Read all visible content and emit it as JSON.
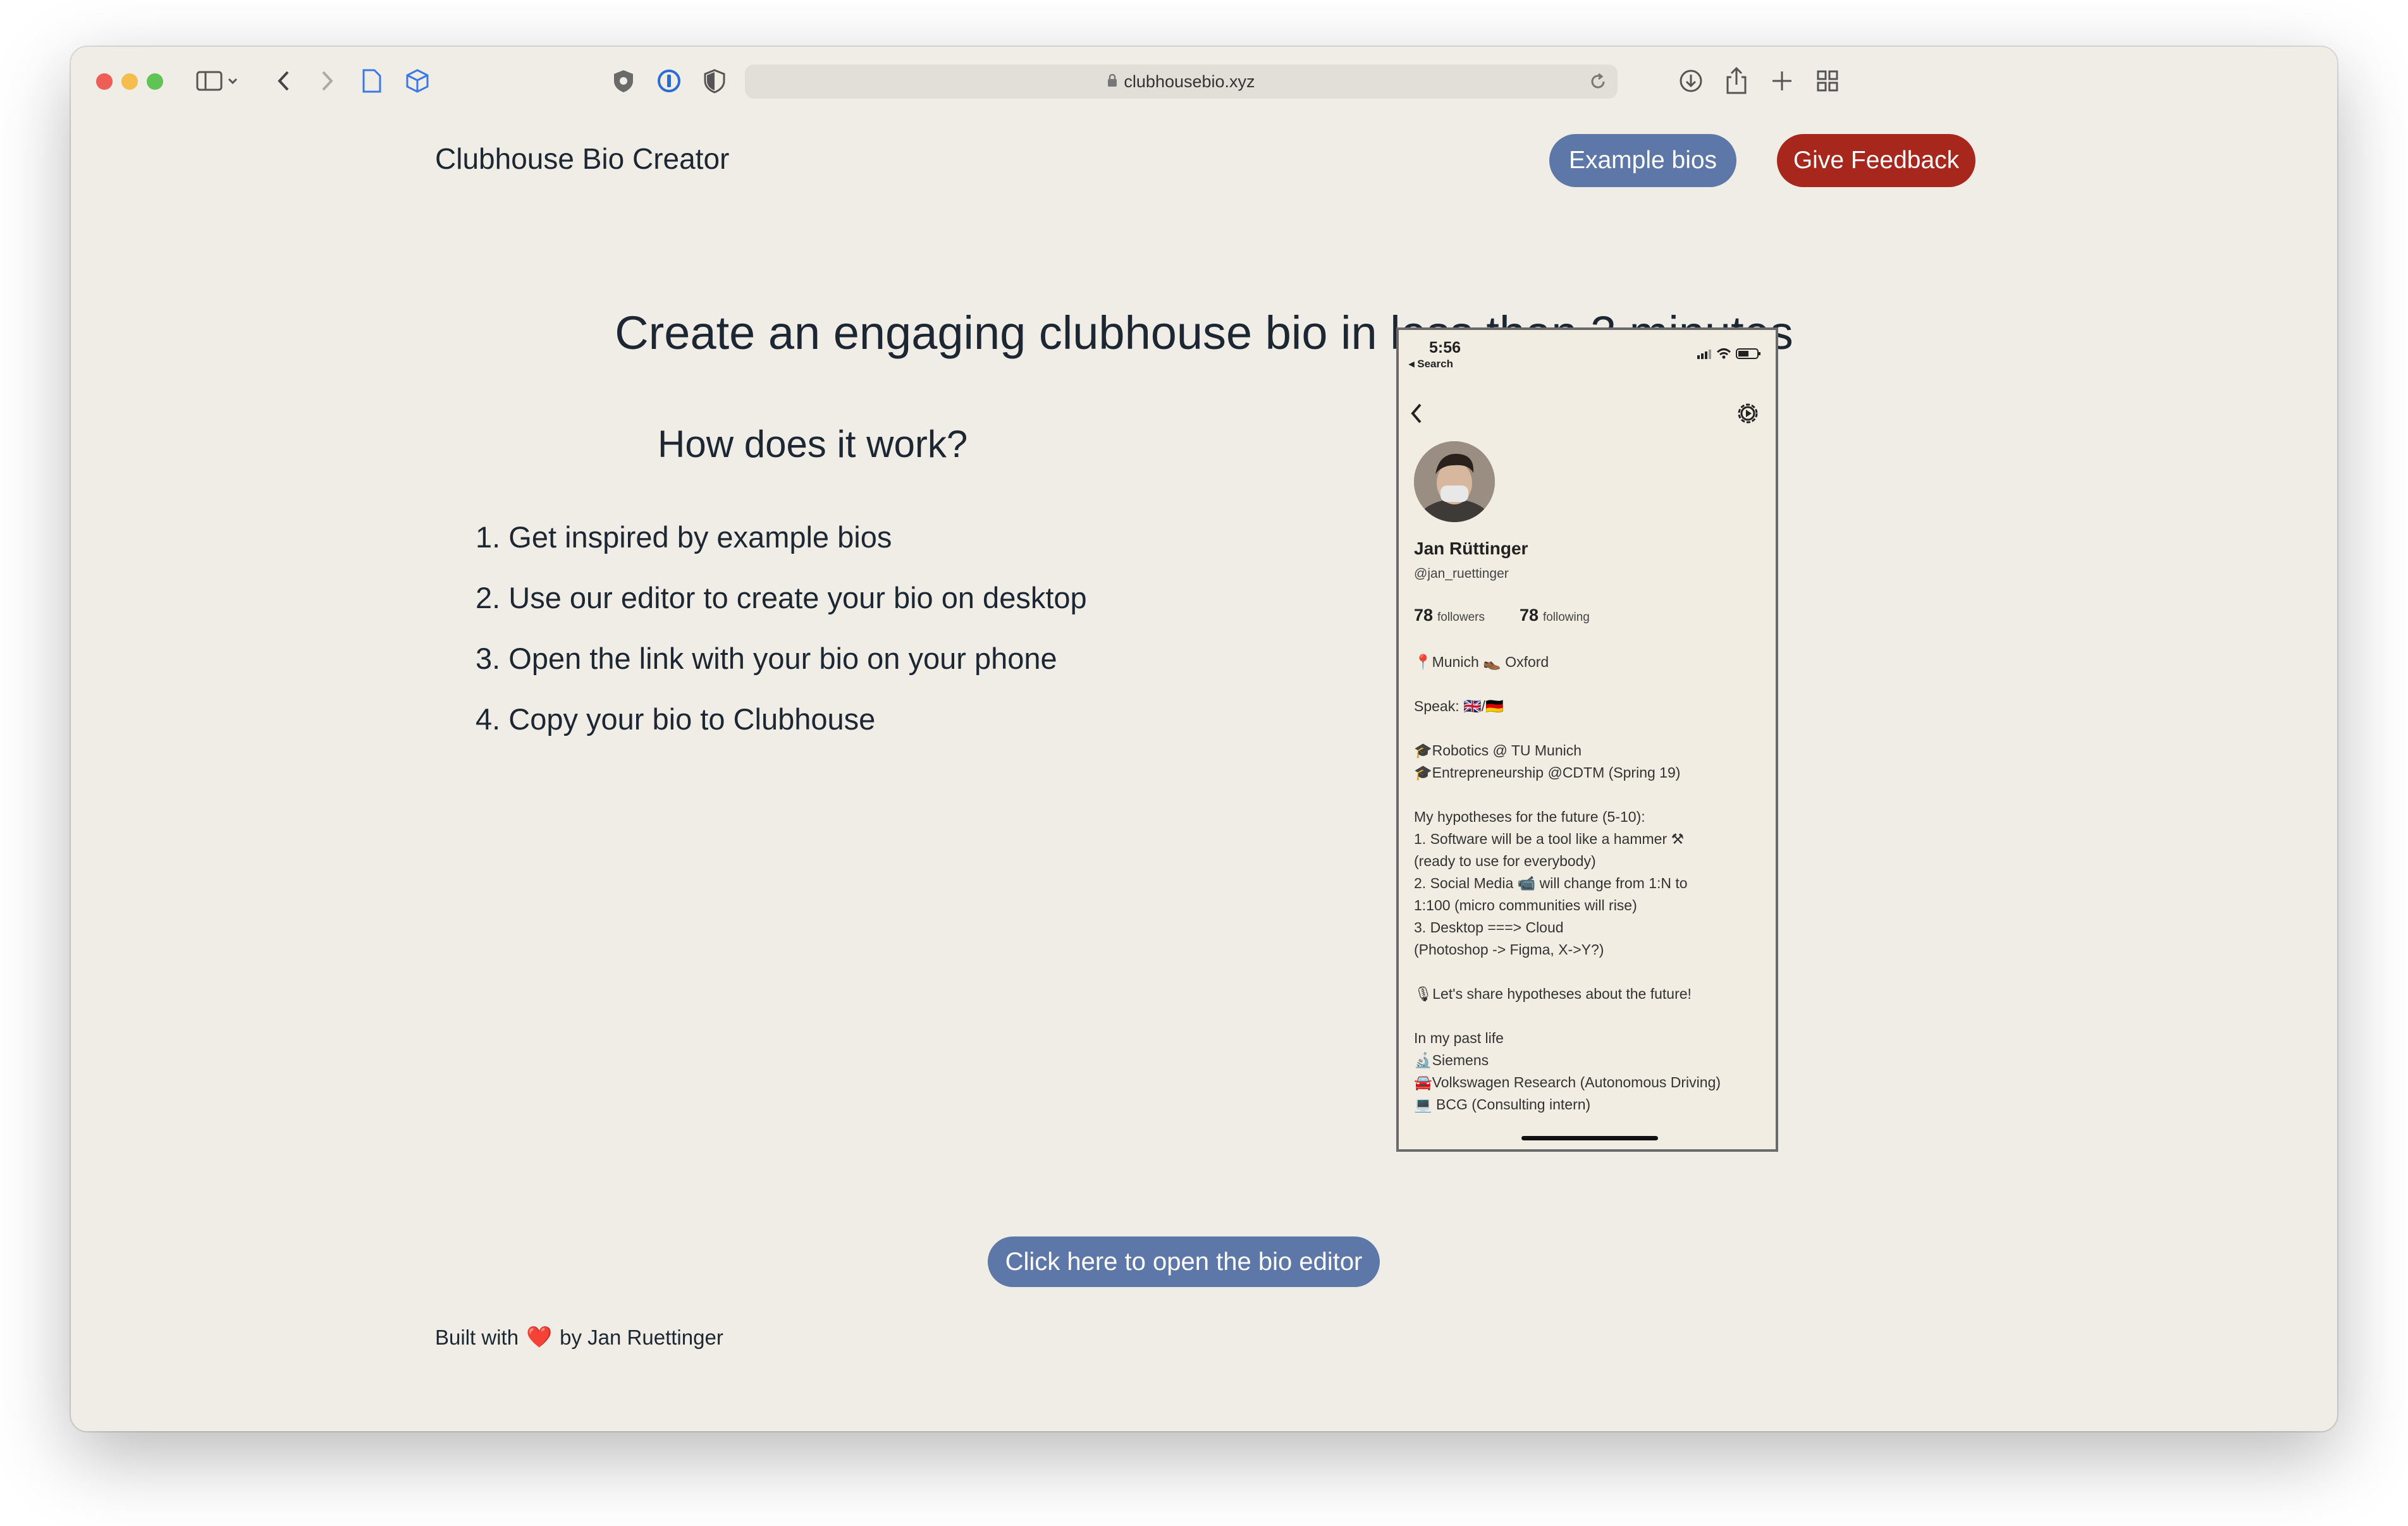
{
  "browser": {
    "url": "clubhousebio.xyz"
  },
  "header": {
    "title": "Clubhouse Bio Creator",
    "examples_label": "Example bios",
    "feedback_label": "Give Feedback"
  },
  "hero": {
    "headline": "Create an engaging clubhouse bio in less than 3 minutes",
    "how_title": "How does it work?",
    "steps": [
      "1. Get inspired by example bios",
      "2. Use our editor to create your bio on desktop",
      "3. Open the link with your bio on your phone",
      "4. Copy your bio to Clubhouse"
    ]
  },
  "phone": {
    "time": "5:56",
    "back_label": "◂ Search",
    "name": "Jan Rüttinger",
    "handle": "@jan_ruettinger",
    "followers_count": "78",
    "followers_label": "followers",
    "following_count": "78",
    "following_label": "following",
    "bio_lines": [
      "📍Munich  👞 Oxford",
      "",
      "Speak: 🇬🇧/🇩🇪",
      "",
      "🎓Robotics @ TU Munich",
      "🎓Entrepreneurship @CDTM (Spring 19)",
      "",
      "My hypotheses for the future (5-10):",
      "1. Software will be a tool like a hammer ⚒",
      "(ready to use for everybody)",
      "2. Social Media 📹 will change from 1:N to",
      "1:100 (micro communities will rise)",
      "3. Desktop ===> Cloud",
      "(Photoshop -> Figma, X->Y?)",
      "",
      "🎙Let's share hypotheses about the future!",
      "",
      "In my past life",
      "🔬Siemens",
      "🚘Volkswagen Research (Autonomous Driving)",
      "💻 BCG (Consulting intern)"
    ]
  },
  "cta": {
    "editor_label": "Click here to open the bio editor"
  },
  "footer": {
    "prefix": "Built with",
    "heart": "❤️",
    "suffix": "by Jan Ruettinger"
  },
  "colors": {
    "page_bg": "#f0ede6",
    "accent_blue": "#5d77a8",
    "accent_red": "#a8271c",
    "text": "#1d2733"
  },
  "icons": [
    "sidebar-icon",
    "chevron-left-icon",
    "chevron-right-icon",
    "page-icon",
    "cube-icon",
    "shield-icon",
    "password-icon",
    "privacy-icon",
    "lock-icon",
    "reload-icon",
    "download-icon",
    "share-icon",
    "plus-icon",
    "tabs-grid-icon",
    "gear-icon"
  ]
}
